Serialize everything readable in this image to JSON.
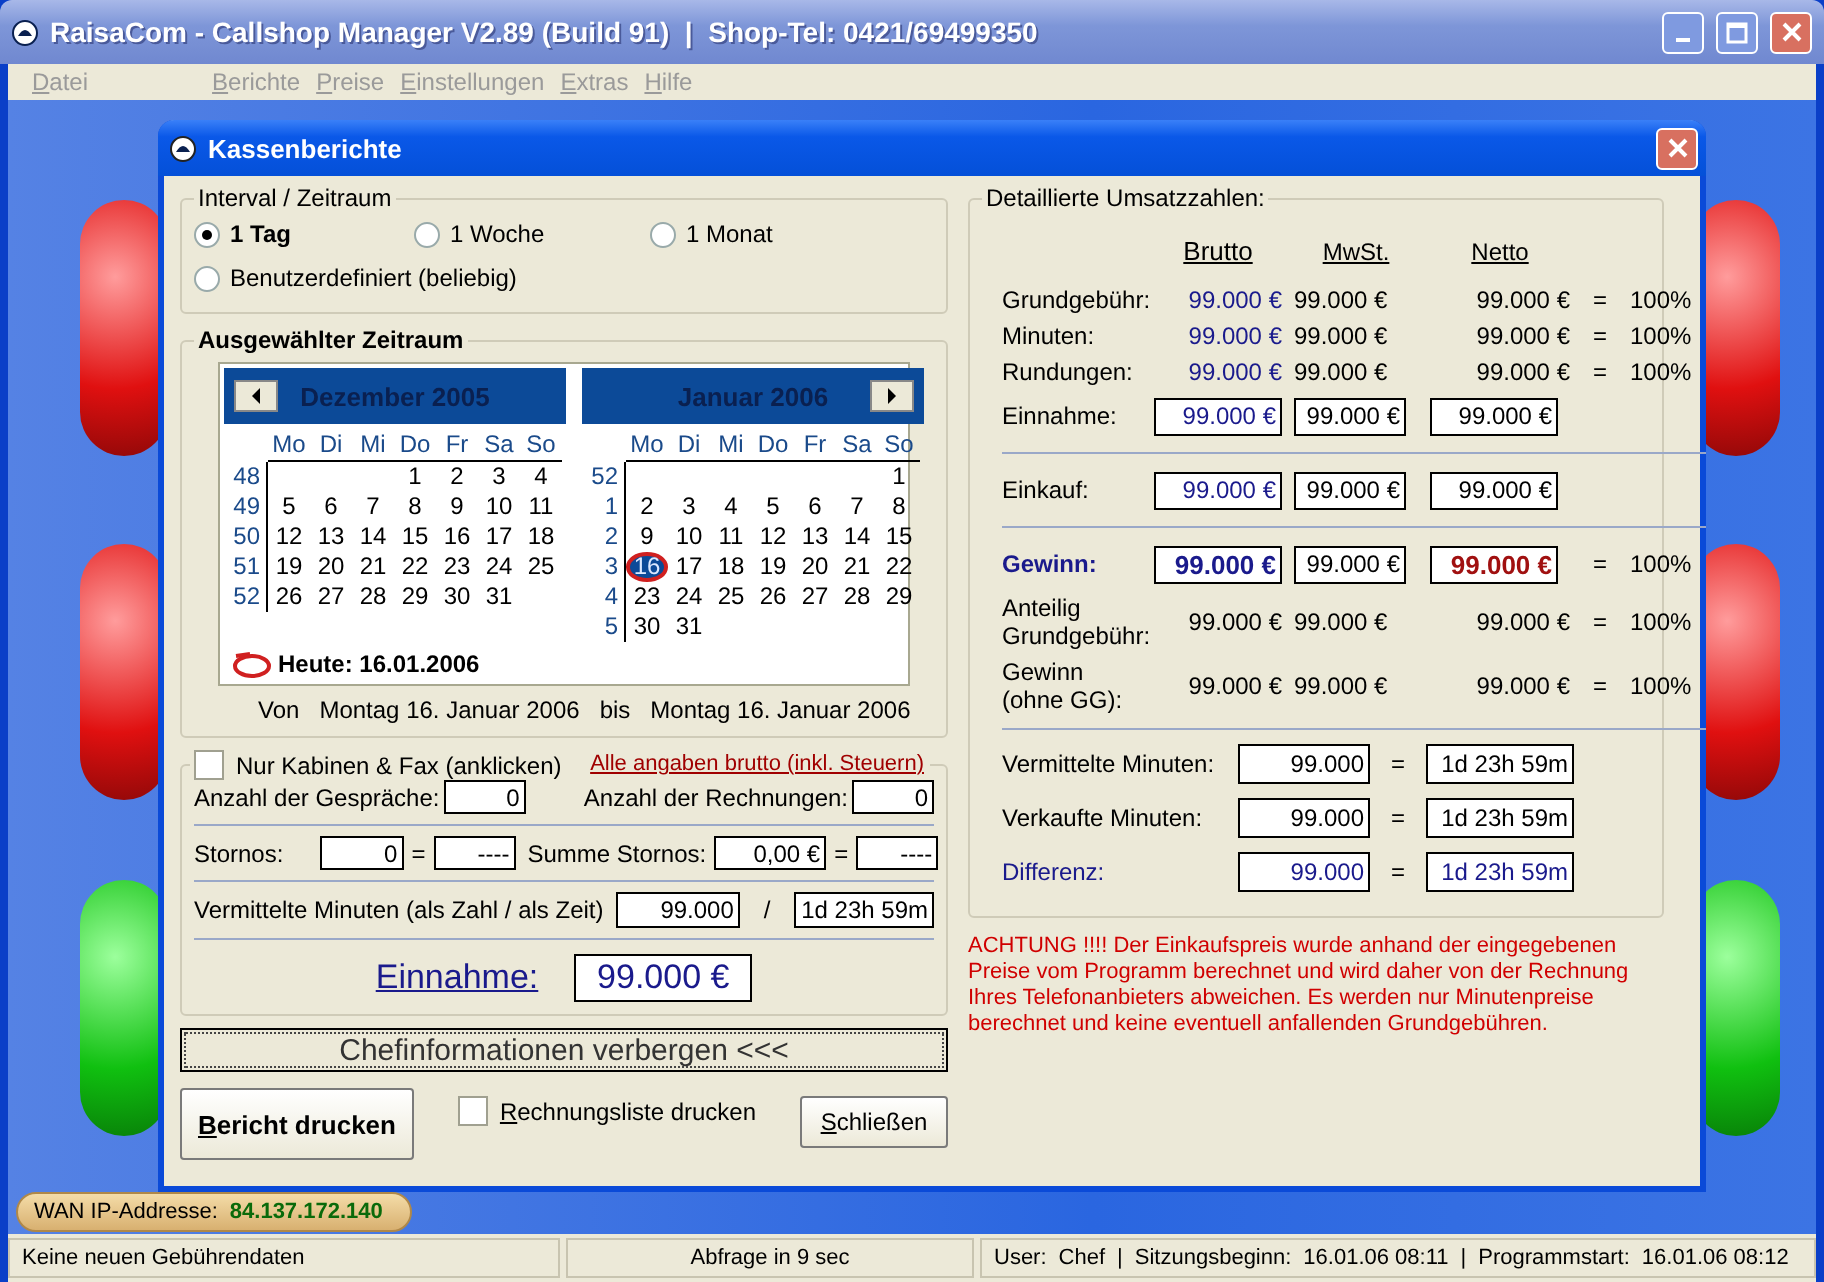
{
  "window": {
    "title": "RaisaCom - Callshop Manager V2.89 (Build 91)  |  Shop-Tel: 0421/69499350"
  },
  "menu": [
    "Datei",
    "Berichte",
    "Preise",
    "Einstellungen",
    "Extras",
    "Hilfe"
  ],
  "dialog": {
    "title": "Kassenberichte",
    "interval": {
      "title": "Interval / Zeitraum",
      "options": [
        {
          "label": "1 Tag",
          "selected": true
        },
        {
          "label": "1 Woche",
          "selected": false
        },
        {
          "label": "1 Monat",
          "selected": false
        },
        {
          "label": "Benutzerdefiniert (beliebig)",
          "selected": false
        }
      ]
    },
    "calendar": {
      "title": "Ausgewählter Zeitraum",
      "months": [
        {
          "title": "Dezember 2005",
          "weekdays": [
            "Mo",
            "Di",
            "Mi",
            "Do",
            "Fr",
            "Sa",
            "So"
          ],
          "weeks": [
            {
              "week": "48",
              "days": [
                {
                  "kind": "blank"
                },
                {
                  "kind": "blank"
                },
                {
                  "kind": "blank"
                },
                {
                  "kind": "day",
                  "day": "1",
                  "selected": false
                },
                {
                  "kind": "day",
                  "day": "2",
                  "selected": false
                },
                {
                  "kind": "day",
                  "day": "3",
                  "selected": false
                },
                {
                  "kind": "day",
                  "day": "4",
                  "selected": false
                }
              ]
            },
            {
              "week": "49",
              "days": [
                {
                  "kind": "day",
                  "day": "5",
                  "selected": false
                },
                {
                  "kind": "day",
                  "day": "6",
                  "selected": false
                },
                {
                  "kind": "day",
                  "day": "7",
                  "selected": false
                },
                {
                  "kind": "day",
                  "day": "8",
                  "selected": false
                },
                {
                  "kind": "day",
                  "day": "9",
                  "selected": false
                },
                {
                  "kind": "day",
                  "day": "10",
                  "selected": false
                },
                {
                  "kind": "day",
                  "day": "11",
                  "selected": false
                }
              ]
            },
            {
              "week": "50",
              "days": [
                {
                  "kind": "day",
                  "day": "12",
                  "selected": false
                },
                {
                  "kind": "day",
                  "day": "13",
                  "selected": false
                },
                {
                  "kind": "day",
                  "day": "14",
                  "selected": false
                },
                {
                  "kind": "day",
                  "day": "15",
                  "selected": false
                },
                {
                  "kind": "day",
                  "day": "16",
                  "selected": false
                },
                {
                  "kind": "day",
                  "day": "17",
                  "selected": false
                },
                {
                  "kind": "day",
                  "day": "18",
                  "selected": false
                }
              ]
            },
            {
              "week": "51",
              "days": [
                {
                  "kind": "day",
                  "day": "19",
                  "selected": false
                },
                {
                  "kind": "day",
                  "day": "20",
                  "selected": false
                },
                {
                  "kind": "day",
                  "day": "21",
                  "selected": false
                },
                {
                  "kind": "day",
                  "day": "22",
                  "selected": false
                },
                {
                  "kind": "day",
                  "day": "23",
                  "selected": false
                },
                {
                  "kind": "day",
                  "day": "24",
                  "selected": false
                },
                {
                  "kind": "day",
                  "day": "25",
                  "selected": false
                }
              ]
            },
            {
              "week": "52",
              "days": [
                {
                  "kind": "day",
                  "day": "26",
                  "selected": false
                },
                {
                  "kind": "day",
                  "day": "27",
                  "selected": false
                },
                {
                  "kind": "day",
                  "day": "28",
                  "selected": false
                },
                {
                  "kind": "day",
                  "day": "29",
                  "selected": false
                },
                {
                  "kind": "day",
                  "day": "30",
                  "selected": false
                },
                {
                  "kind": "day",
                  "day": "31",
                  "selected": false
                }
              ]
            }
          ]
        },
        {
          "title": "Januar 2006",
          "weekdays": [
            "Mo",
            "Di",
            "Mi",
            "Do",
            "Fr",
            "Sa",
            "So"
          ],
          "weeks": [
            {
              "week": "52",
              "days": [
                {
                  "kind": "blank"
                },
                {
                  "kind": "blank"
                },
                {
                  "kind": "blank"
                },
                {
                  "kind": "blank"
                },
                {
                  "kind": "blank"
                },
                {
                  "kind": "blank"
                },
                {
                  "kind": "day",
                  "day": "1",
                  "selected": false
                }
              ]
            },
            {
              "week": "1",
              "days": [
                {
                  "kind": "day",
                  "day": "2",
                  "selected": false
                },
                {
                  "kind": "day",
                  "day": "3",
                  "selected": false
                },
                {
                  "kind": "day",
                  "day": "4",
                  "selected": false
                },
                {
                  "kind": "day",
                  "day": "5",
                  "selected": false
                },
                {
                  "kind": "day",
                  "day": "6",
                  "selected": false
                },
                {
                  "kind": "day",
                  "day": "7",
                  "selected": false
                },
                {
                  "kind": "day",
                  "day": "8",
                  "selected": false
                }
              ]
            },
            {
              "week": "2",
              "days": [
                {
                  "kind": "day",
                  "day": "9",
                  "selected": false
                },
                {
                  "kind": "day",
                  "day": "10",
                  "selected": false
                },
                {
                  "kind": "day",
                  "day": "11",
                  "selected": false
                },
                {
                  "kind": "day",
                  "day": "12",
                  "selected": false
                },
                {
                  "kind": "day",
                  "day": "13",
                  "selected": false
                },
                {
                  "kind": "day",
                  "day": "14",
                  "selected": false
                },
                {
                  "kind": "day",
                  "day": "15",
                  "selected": false
                }
              ]
            },
            {
              "week": "3",
              "days": [
                {
                  "kind": "day",
                  "day": "16",
                  "selected": true
                },
                {
                  "kind": "day",
                  "day": "17",
                  "selected": false
                },
                {
                  "kind": "day",
                  "day": "18",
                  "selected": false
                },
                {
                  "kind": "day",
                  "day": "19",
                  "selected": false
                },
                {
                  "kind": "day",
                  "day": "20",
                  "selected": false
                },
                {
                  "kind": "day",
                  "day": "21",
                  "selected": false
                },
                {
                  "kind": "day",
                  "day": "22",
                  "selected": false
                }
              ]
            },
            {
              "week": "4",
              "days": [
                {
                  "kind": "day",
                  "day": "23",
                  "selected": false
                },
                {
                  "kind": "day",
                  "day": "24",
                  "selected": false
                },
                {
                  "kind": "day",
                  "day": "25",
                  "selected": false
                },
                {
                  "kind": "day",
                  "day": "26",
                  "selected": false
                },
                {
                  "kind": "day",
                  "day": "27",
                  "selected": false
                },
                {
                  "kind": "day",
                  "day": "28",
                  "selected": false
                },
                {
                  "kind": "day",
                  "day": "29",
                  "selected": false
                }
              ]
            },
            {
              "week": "5",
              "days": [
                {
                  "kind": "day",
                  "day": "30",
                  "selected": false
                },
                {
                  "kind": "day",
                  "day": "31",
                  "selected": false
                }
              ]
            }
          ]
        }
      ],
      "today": "Heute: 16.01.2006",
      "range": {
        "from_label": "Von",
        "from": "Montag 16. Januar 2006",
        "to_label": "bis",
        "to": "Montag 16. Januar 2006"
      }
    },
    "cabins": {
      "checkbox": {
        "label": "Nur Kabinen & Fax (anklicken)",
        "checked": false
      },
      "note": "Alle angaben brutto (inkl. Steuern)",
      "counts": [
        {
          "label": "Anzahl der Gespräche:",
          "value": "0"
        },
        {
          "label": "Anzahl der Rechnungen:",
          "value": "0"
        }
      ],
      "stornos": [
        {
          "label": "Stornos:",
          "value": "0",
          "eq": "=",
          "result": "----"
        },
        {
          "label": "Summe Stornos:",
          "value": "0,00 €",
          "eq": "=",
          "result": "----"
        }
      ],
      "minutes": {
        "label": "Vermittelte Minuten (als Zahl / als Zeit)",
        "value": "99.000",
        "sep": "/",
        "time": "1d 23h 59m"
      },
      "income": {
        "label": "Einnahme:",
        "value": "99.000 €"
      }
    },
    "toggle_button": "Chefinformationen verbergen <<<",
    "print_button": "Bericht drucken",
    "invoice_checkbox": {
      "label": "Rechnungsliste drucken",
      "checked": false
    },
    "close_button": "Schließen",
    "details": {
      "title": "Detaillierte Umsatzzahlen:",
      "columns": [
        "Brutto",
        "MwSt.",
        "Netto"
      ],
      "rows": [
        {
          "kind": "line",
          "label": "Grundgebühr:",
          "brutto": "99.000 €",
          "mwst": "99.000 €",
          "netto": "99.000 €",
          "eq": "=",
          "pct": "100%"
        },
        {
          "kind": "line",
          "label": "Minuten:",
          "brutto": "99.000 €",
          "mwst": "99.000 €",
          "netto": "99.000 €",
          "eq": "=",
          "pct": "100%"
        },
        {
          "kind": "line",
          "label": "Rundungen:",
          "brutto": "99.000 €",
          "mwst": "99.000 €",
          "netto": "99.000 €",
          "eq": "=",
          "pct": "100%"
        },
        {
          "kind": "field",
          "label": "Einnahme:",
          "brutto": "99.000 €",
          "mwst": "99.000 €",
          "netto": "99.000 €"
        },
        {
          "kind": "divider"
        },
        {
          "kind": "field",
          "label": "Einkauf:",
          "brutto": "99.000 €",
          "mwst": "99.000 €",
          "netto": "99.000 €"
        },
        {
          "kind": "divider"
        },
        {
          "kind": "total",
          "label": "Gewinn:",
          "brutto": "99.000 €",
          "mwst": "99.000 €",
          "netto": "99.000 €",
          "eq": "=",
          "pct": "100%"
        },
        {
          "kind": "share",
          "label": "Anteilig Grundgebühr:",
          "brutto": "99.000 €",
          "mwst": "99.000 €",
          "netto": "99.000 €",
          "eq": "=",
          "pct": "100%"
        },
        {
          "kind": "share",
          "label": "Gewinn (ohne GG):",
          "brutto": "99.000 €",
          "mwst": "99.000 €",
          "netto": "99.000 €",
          "eq": "=",
          "pct": "100%"
        },
        {
          "kind": "divider"
        }
      ],
      "minutes": [
        {
          "kind": "plain",
          "label": "Vermittelte Minuten:",
          "value": "99.000",
          "eq": "=",
          "time": "1d 23h 59m"
        },
        {
          "kind": "plain",
          "label": "Verkaufte Minuten:",
          "value": "99.000",
          "eq": "=",
          "time": "1d 23h 59m"
        },
        {
          "kind": "difference",
          "label": "Differenz:",
          "value": "99.000",
          "eq": "=",
          "time": "1d 23h 59m"
        }
      ]
    },
    "warning": "ACHTUNG !!!! Der Einkaufspreis wurde anhand der eingegebenen Preise vom Programm berechnet und wird daher von der Rechnung Ihres Telefonanbieters abweichen. Es werden nur Minutenpreise berechnet und keine eventuell anfallenden Grundgebühren."
  },
  "wan": {
    "label": "WAN IP-Addresse:",
    "value": "84.137.172.140"
  },
  "status_bar": {
    "message": "Keine neuen Gebührendaten",
    "poll": "Abfrage in 9 sec",
    "session": [
      {
        "label": "User:",
        "value": "Chef"
      },
      {
        "sep": "|",
        "label": "Sitzungsbeginn:",
        "value": "16.01.06 08:11"
      },
      {
        "sep": "|",
        "label": "Programmstart:",
        "value": "16.01.06 08:12"
      }
    ]
  }
}
